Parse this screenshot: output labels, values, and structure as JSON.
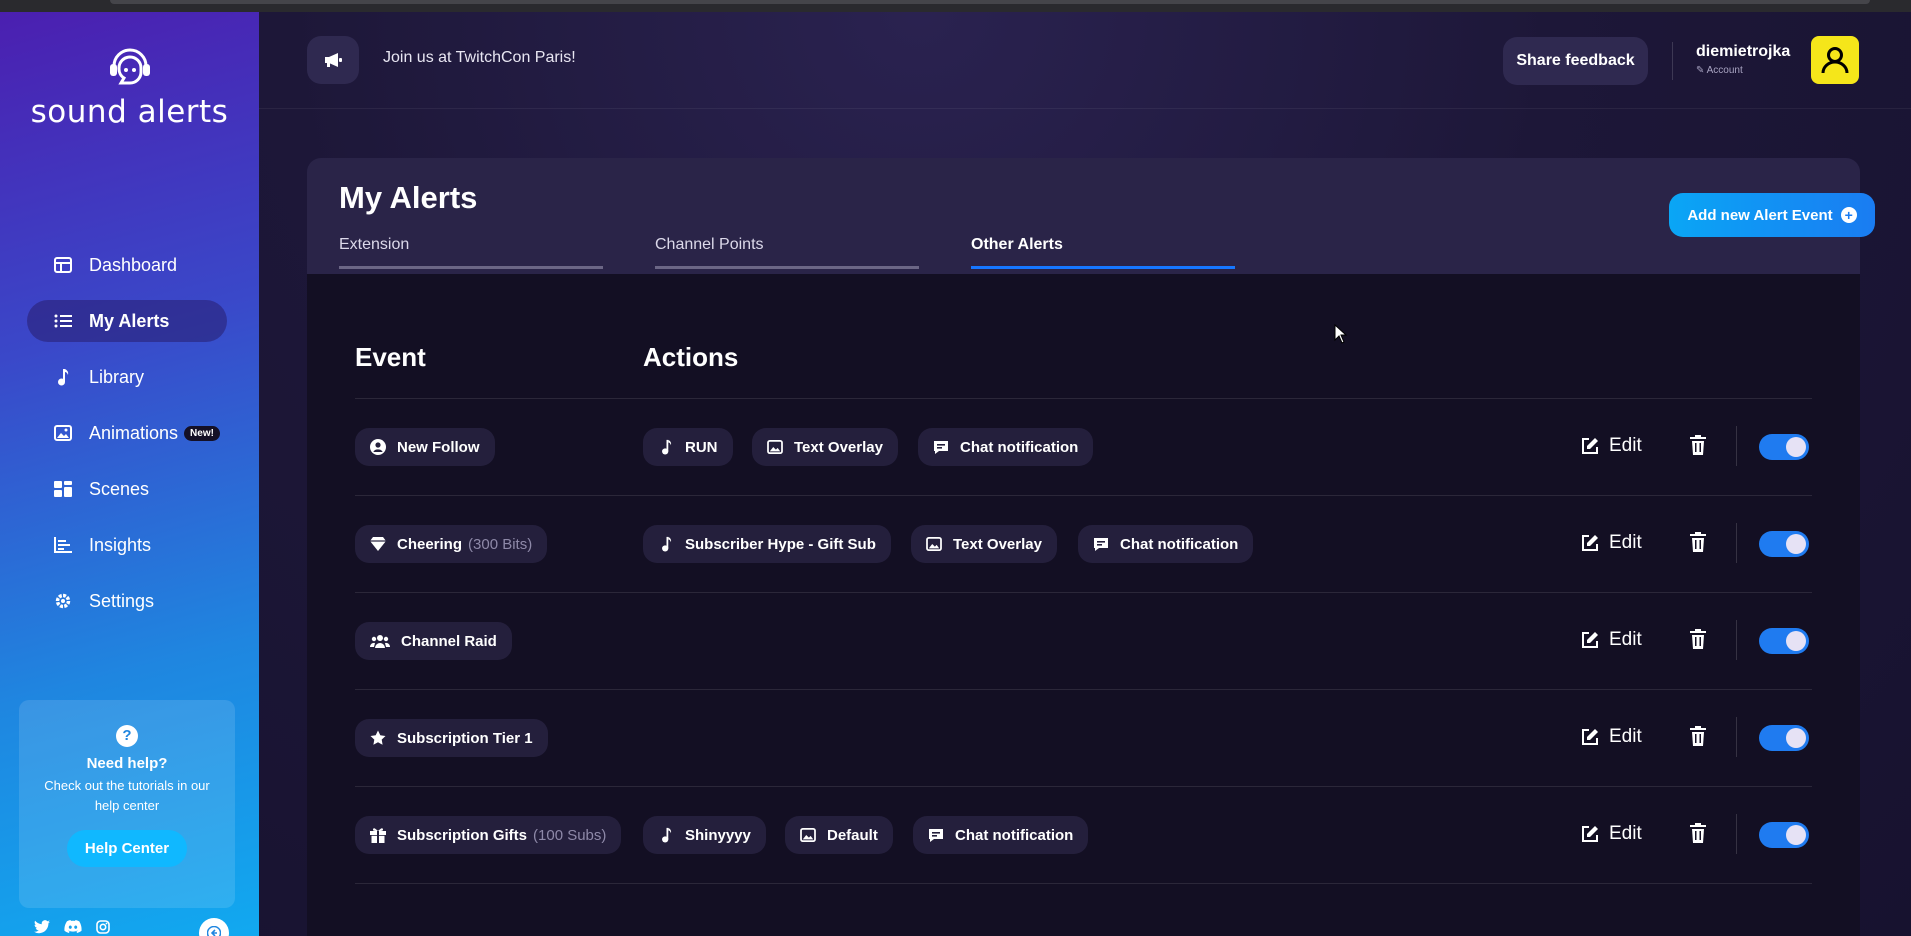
{
  "sidebar": {
    "brand": "sound alerts",
    "nav": [
      {
        "label": "Dashboard",
        "icon": "dashboard-icon"
      },
      {
        "label": "My Alerts",
        "icon": "list-icon",
        "active": true
      },
      {
        "label": "Library",
        "icon": "music-note-icon"
      },
      {
        "label": "Animations",
        "icon": "image-icon",
        "badge": "New!"
      },
      {
        "label": "Scenes",
        "icon": "scenes-grid-icon"
      },
      {
        "label": "Insights",
        "icon": "bar-chart-icon"
      },
      {
        "label": "Settings",
        "icon": "gear-icon"
      }
    ],
    "help": {
      "title": "Need help?",
      "subtitle": "Check out the tutorials in our help center",
      "button": "Help Center"
    }
  },
  "topbar": {
    "announcement": "Join us at TwitchCon Paris!",
    "feedback": "Share feedback",
    "username": "diemietrojka",
    "account_label": "Account"
  },
  "page": {
    "title": "My Alerts",
    "tabs": [
      {
        "label": "Extension"
      },
      {
        "label": "Channel Points"
      },
      {
        "label": "Other Alerts",
        "active": true
      }
    ],
    "add_button": "Add new Alert Event",
    "columns": {
      "event": "Event",
      "actions": "Actions"
    },
    "edit_label": "Edit"
  },
  "alerts": [
    {
      "event": {
        "label": "New Follow",
        "icon": "user-circle-icon",
        "detail": ""
      },
      "actions": [
        {
          "label": "RUN",
          "icon": "music-note-icon"
        },
        {
          "label": "Text Overlay",
          "icon": "image-icon"
        },
        {
          "label": "Chat notification",
          "icon": "chat-icon"
        }
      ],
      "enabled": true
    },
    {
      "event": {
        "label": "Cheering",
        "icon": "diamond-icon",
        "detail": "(300 Bits)"
      },
      "actions": [
        {
          "label": "Subscriber Hype - Gift Sub",
          "icon": "music-note-icon"
        },
        {
          "label": "Text Overlay",
          "icon": "image-icon"
        },
        {
          "label": "Chat notification",
          "icon": "chat-icon"
        }
      ],
      "enabled": true
    },
    {
      "event": {
        "label": "Channel Raid",
        "icon": "users-icon",
        "detail": ""
      },
      "actions": [],
      "enabled": true
    },
    {
      "event": {
        "label": "Subscription Tier 1",
        "icon": "star-icon",
        "detail": ""
      },
      "actions": [],
      "enabled": true
    },
    {
      "event": {
        "label": "Subscription Gifts",
        "icon": "gift-icon",
        "detail": "(100 Subs)"
      },
      "actions": [
        {
          "label": "Shinyyyy",
          "icon": "music-note-icon"
        },
        {
          "label": "Default",
          "icon": "image-icon"
        },
        {
          "label": "Chat notification",
          "icon": "chat-icon"
        }
      ],
      "enabled": true
    }
  ],
  "colors": {
    "accent": "#1677ff",
    "toggle_on": "#1f7bf0",
    "avatar_bg": "#f5e61a"
  }
}
